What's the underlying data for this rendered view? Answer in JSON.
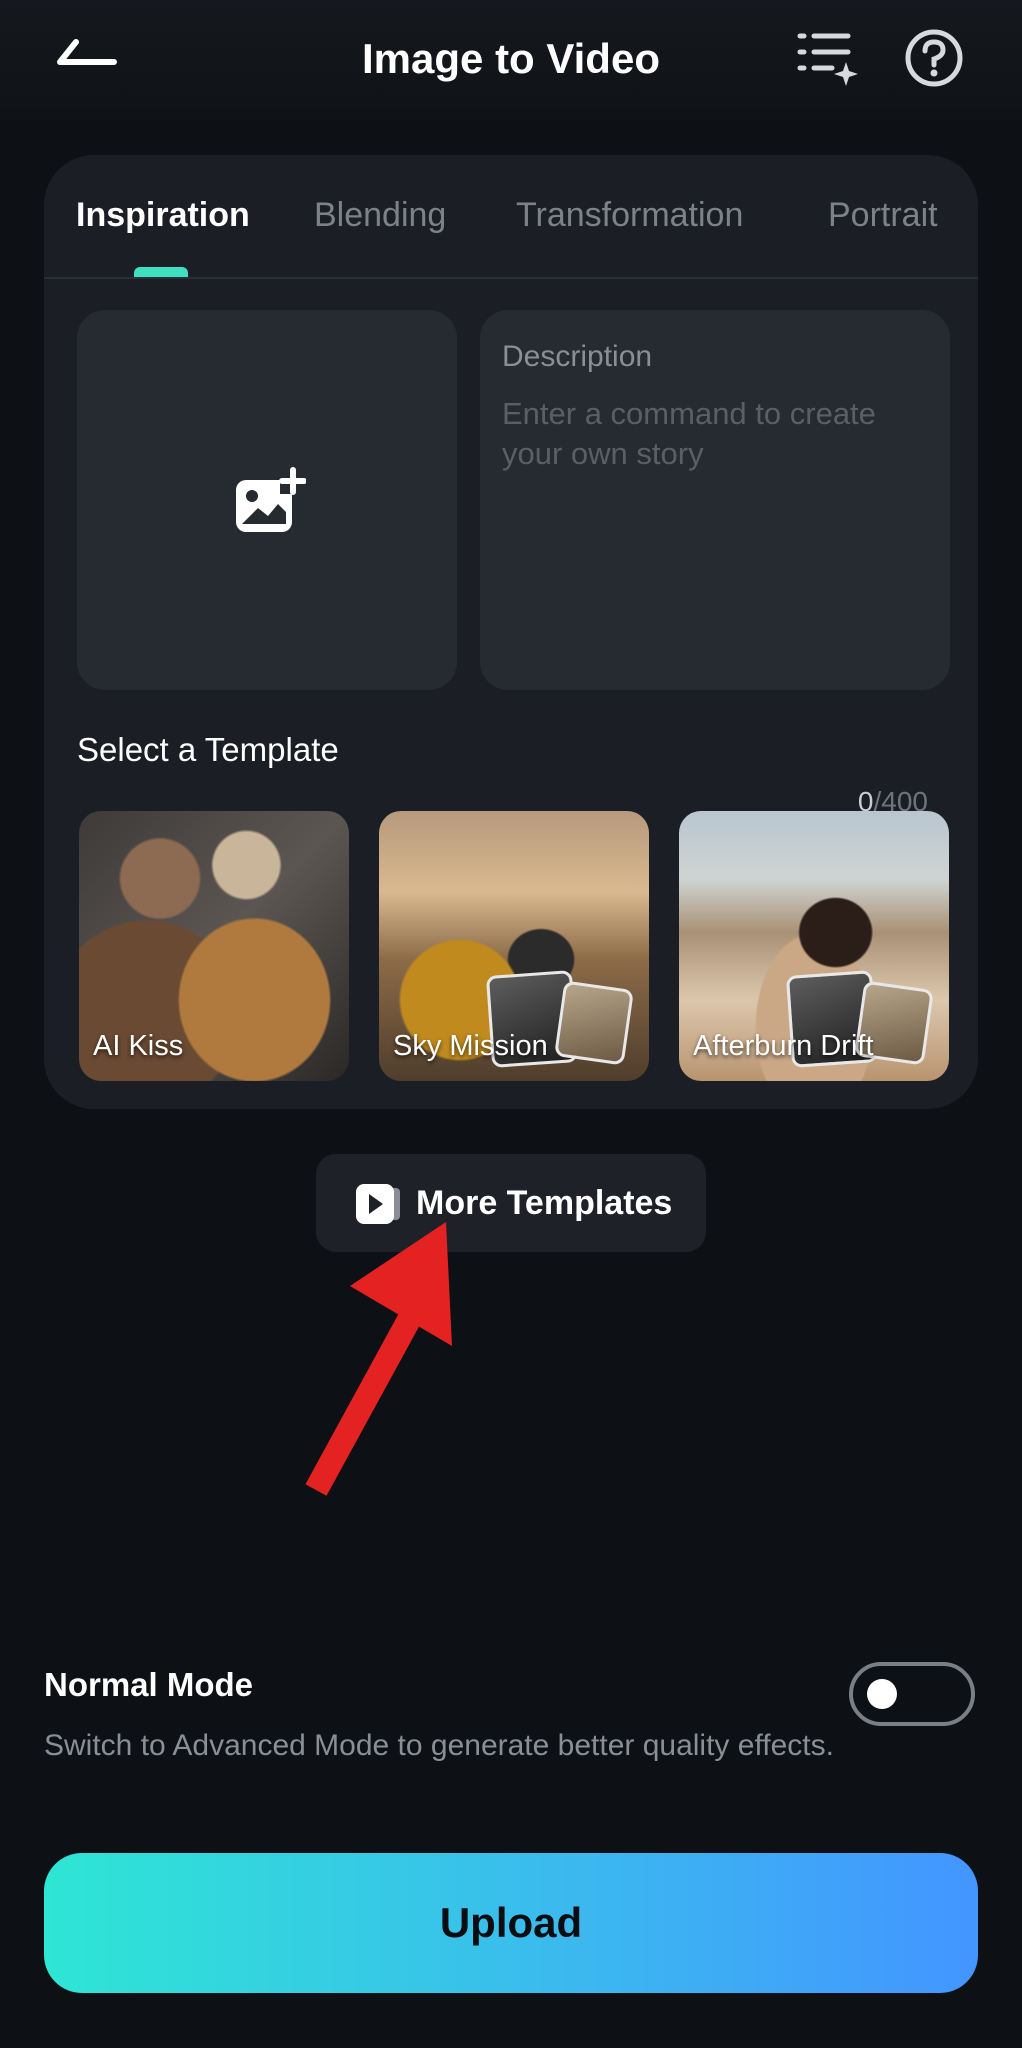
{
  "header": {
    "title": "Image to Video",
    "back_icon": "back-arrow-icon",
    "list_icon": "sparkle-list-icon",
    "help_icon": "help-circle-icon"
  },
  "tabs": [
    {
      "label": "Inspiration",
      "active": true
    },
    {
      "label": "Blending",
      "active": false
    },
    {
      "label": "Transformation",
      "active": false
    },
    {
      "label": "Portrait",
      "active": false
    }
  ],
  "upload_area": {
    "icon": "add-image-icon"
  },
  "description": {
    "label": "Description",
    "placeholder": "Enter a command to create your own story",
    "count_current": "0",
    "count_max": "/400"
  },
  "templates": {
    "title": "Select a Template",
    "items": [
      {
        "label": "AI Kiss"
      },
      {
        "label": "Sky Mission"
      },
      {
        "label": "Afterburn Drift"
      }
    ]
  },
  "more_templates": {
    "label": "More Templates",
    "icon": "video-play-icon"
  },
  "mode": {
    "title": "Normal Mode",
    "description": "Switch to Advanced Mode to generate better quality effects.",
    "advanced_enabled": false
  },
  "upload_button": {
    "label": "Upload"
  },
  "colors": {
    "background": "#0d1014",
    "card": "#1b1f25",
    "accent": "#3fe0c0",
    "upload_gradient_start": "#2ee6d4",
    "upload_gradient_end": "#4395ff",
    "annotation_arrow": "#e52222"
  }
}
